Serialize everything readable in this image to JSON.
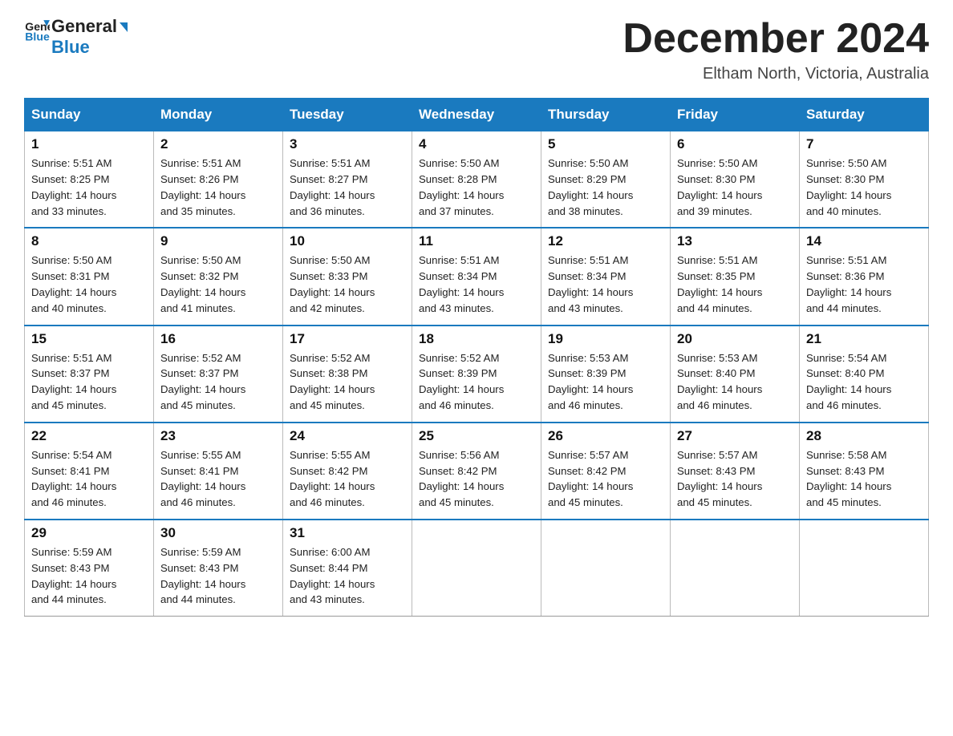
{
  "header": {
    "logo_line1": "General",
    "logo_line2": "Blue",
    "month_title": "December 2024",
    "location": "Eltham North, Victoria, Australia"
  },
  "weekdays": [
    "Sunday",
    "Monday",
    "Tuesday",
    "Wednesday",
    "Thursday",
    "Friday",
    "Saturday"
  ],
  "weeks": [
    [
      {
        "day": "1",
        "sunrise": "5:51 AM",
        "sunset": "8:25 PM",
        "daylight": "14 hours and 33 minutes."
      },
      {
        "day": "2",
        "sunrise": "5:51 AM",
        "sunset": "8:26 PM",
        "daylight": "14 hours and 35 minutes."
      },
      {
        "day": "3",
        "sunrise": "5:51 AM",
        "sunset": "8:27 PM",
        "daylight": "14 hours and 36 minutes."
      },
      {
        "day": "4",
        "sunrise": "5:50 AM",
        "sunset": "8:28 PM",
        "daylight": "14 hours and 37 minutes."
      },
      {
        "day": "5",
        "sunrise": "5:50 AM",
        "sunset": "8:29 PM",
        "daylight": "14 hours and 38 minutes."
      },
      {
        "day": "6",
        "sunrise": "5:50 AM",
        "sunset": "8:30 PM",
        "daylight": "14 hours and 39 minutes."
      },
      {
        "day": "7",
        "sunrise": "5:50 AM",
        "sunset": "8:30 PM",
        "daylight": "14 hours and 40 minutes."
      }
    ],
    [
      {
        "day": "8",
        "sunrise": "5:50 AM",
        "sunset": "8:31 PM",
        "daylight": "14 hours and 40 minutes."
      },
      {
        "day": "9",
        "sunrise": "5:50 AM",
        "sunset": "8:32 PM",
        "daylight": "14 hours and 41 minutes."
      },
      {
        "day": "10",
        "sunrise": "5:50 AM",
        "sunset": "8:33 PM",
        "daylight": "14 hours and 42 minutes."
      },
      {
        "day": "11",
        "sunrise": "5:51 AM",
        "sunset": "8:34 PM",
        "daylight": "14 hours and 43 minutes."
      },
      {
        "day": "12",
        "sunrise": "5:51 AM",
        "sunset": "8:34 PM",
        "daylight": "14 hours and 43 minutes."
      },
      {
        "day": "13",
        "sunrise": "5:51 AM",
        "sunset": "8:35 PM",
        "daylight": "14 hours and 44 minutes."
      },
      {
        "day": "14",
        "sunrise": "5:51 AM",
        "sunset": "8:36 PM",
        "daylight": "14 hours and 44 minutes."
      }
    ],
    [
      {
        "day": "15",
        "sunrise": "5:51 AM",
        "sunset": "8:37 PM",
        "daylight": "14 hours and 45 minutes."
      },
      {
        "day": "16",
        "sunrise": "5:52 AM",
        "sunset": "8:37 PM",
        "daylight": "14 hours and 45 minutes."
      },
      {
        "day": "17",
        "sunrise": "5:52 AM",
        "sunset": "8:38 PM",
        "daylight": "14 hours and 45 minutes."
      },
      {
        "day": "18",
        "sunrise": "5:52 AM",
        "sunset": "8:39 PM",
        "daylight": "14 hours and 46 minutes."
      },
      {
        "day": "19",
        "sunrise": "5:53 AM",
        "sunset": "8:39 PM",
        "daylight": "14 hours and 46 minutes."
      },
      {
        "day": "20",
        "sunrise": "5:53 AM",
        "sunset": "8:40 PM",
        "daylight": "14 hours and 46 minutes."
      },
      {
        "day": "21",
        "sunrise": "5:54 AM",
        "sunset": "8:40 PM",
        "daylight": "14 hours and 46 minutes."
      }
    ],
    [
      {
        "day": "22",
        "sunrise": "5:54 AM",
        "sunset": "8:41 PM",
        "daylight": "14 hours and 46 minutes."
      },
      {
        "day": "23",
        "sunrise": "5:55 AM",
        "sunset": "8:41 PM",
        "daylight": "14 hours and 46 minutes."
      },
      {
        "day": "24",
        "sunrise": "5:55 AM",
        "sunset": "8:42 PM",
        "daylight": "14 hours and 46 minutes."
      },
      {
        "day": "25",
        "sunrise": "5:56 AM",
        "sunset": "8:42 PM",
        "daylight": "14 hours and 45 minutes."
      },
      {
        "day": "26",
        "sunrise": "5:57 AM",
        "sunset": "8:42 PM",
        "daylight": "14 hours and 45 minutes."
      },
      {
        "day": "27",
        "sunrise": "5:57 AM",
        "sunset": "8:43 PM",
        "daylight": "14 hours and 45 minutes."
      },
      {
        "day": "28",
        "sunrise": "5:58 AM",
        "sunset": "8:43 PM",
        "daylight": "14 hours and 45 minutes."
      }
    ],
    [
      {
        "day": "29",
        "sunrise": "5:59 AM",
        "sunset": "8:43 PM",
        "daylight": "14 hours and 44 minutes."
      },
      {
        "day": "30",
        "sunrise": "5:59 AM",
        "sunset": "8:43 PM",
        "daylight": "14 hours and 44 minutes."
      },
      {
        "day": "31",
        "sunrise": "6:00 AM",
        "sunset": "8:44 PM",
        "daylight": "14 hours and 43 minutes."
      },
      null,
      null,
      null,
      null
    ]
  ],
  "labels": {
    "sunrise": "Sunrise:",
    "sunset": "Sunset:",
    "daylight": "Daylight:"
  }
}
